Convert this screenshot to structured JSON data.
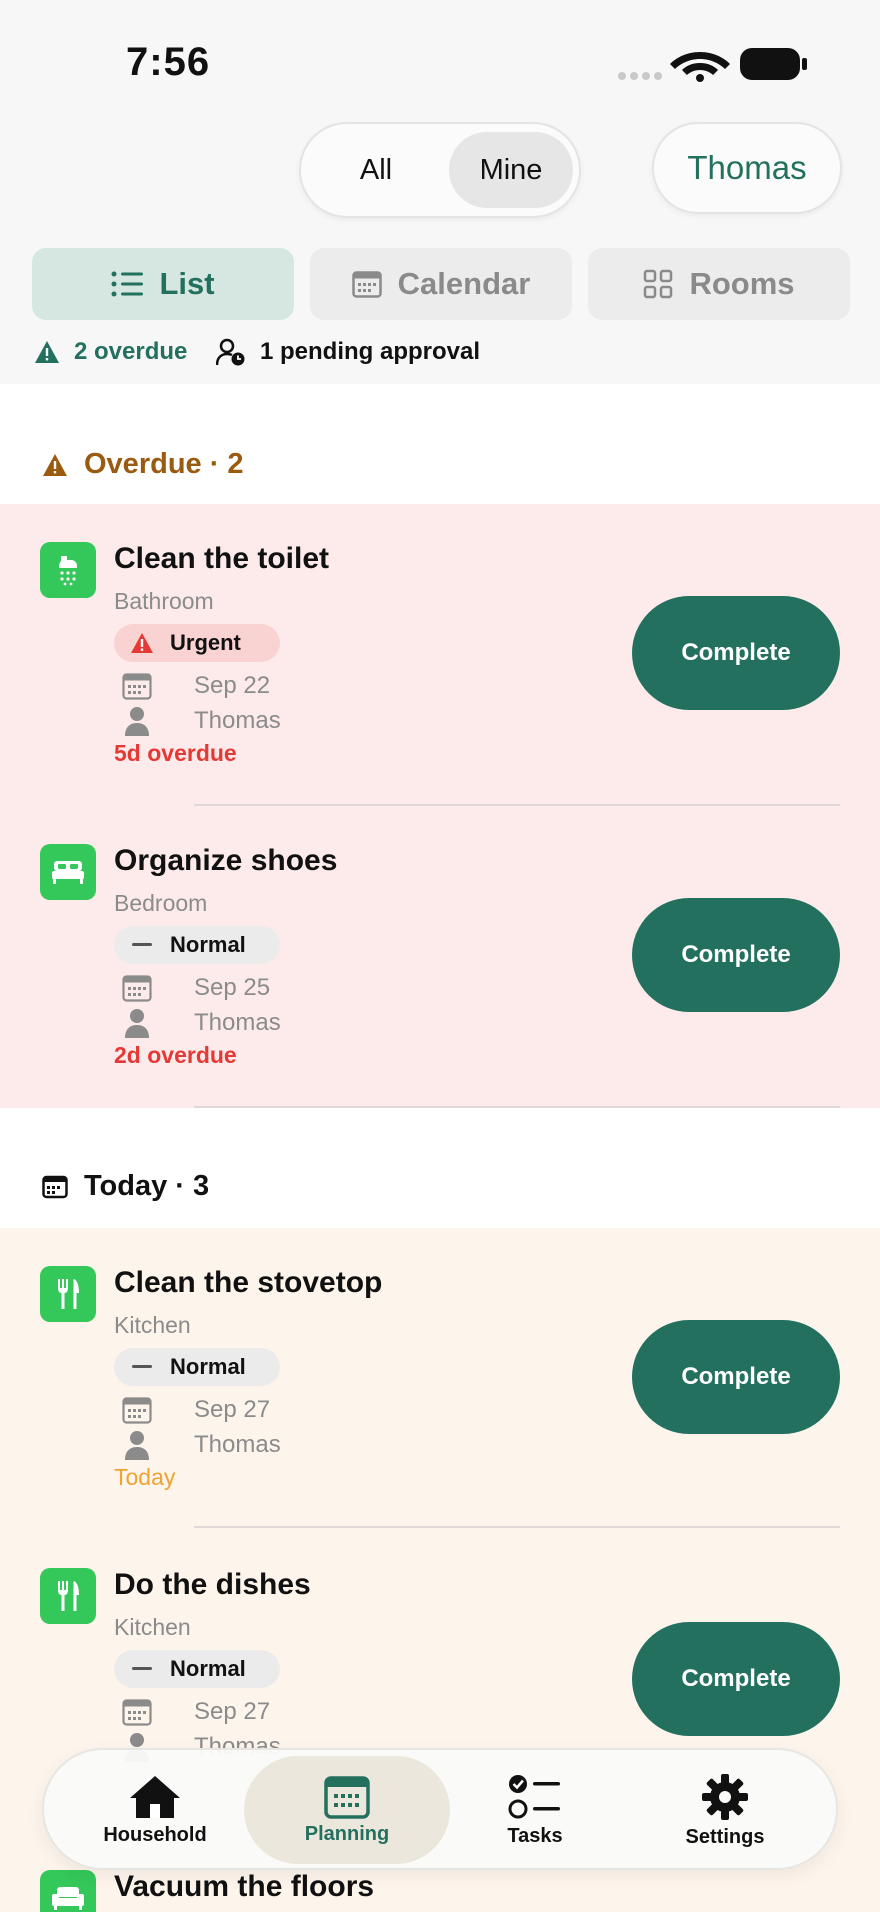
{
  "status_bar": {
    "time": "7:56"
  },
  "filter": {
    "all": "All",
    "mine": "Mine",
    "selected": "Mine"
  },
  "user": {
    "name": "Thomas"
  },
  "view_tabs": [
    {
      "label": "List",
      "icon": "list-icon",
      "active": true
    },
    {
      "label": "Calendar",
      "icon": "calendar-icon",
      "active": false
    },
    {
      "label": "Rooms",
      "icon": "grid-icon",
      "active": false
    }
  ],
  "summary": {
    "overdue": "2 overdue",
    "pending": "1 pending approval"
  },
  "sections": {
    "overdue": {
      "title": "Overdue · 2",
      "tasks": [
        {
          "title": "Clean the toilet",
          "room": "Bathroom",
          "priority": "Urgent",
          "date": "Sep 22",
          "assignee": "Thomas",
          "status": "5d overdue",
          "action": "Complete",
          "icon": "shower-icon"
        },
        {
          "title": "Organize shoes",
          "room": "Bedroom",
          "priority": "Normal",
          "date": "Sep 25",
          "assignee": "Thomas",
          "status": "2d overdue",
          "action": "Complete",
          "icon": "bed-icon"
        }
      ]
    },
    "today": {
      "title": "Today · 3",
      "tasks": [
        {
          "title": "Clean the stovetop",
          "room": "Kitchen",
          "priority": "Normal",
          "date": "Sep 27",
          "assignee": "Thomas",
          "status": "Today",
          "action": "Complete",
          "icon": "fork-knife-icon"
        },
        {
          "title": "Do the dishes",
          "room": "Kitchen",
          "priority": "Normal",
          "date": "Sep 27",
          "assignee": "Thomas",
          "status": "",
          "action": "Complete",
          "icon": "fork-knife-icon"
        },
        {
          "title": "Vacuum the floors",
          "icon": "sofa-icon"
        }
      ]
    }
  },
  "tabbar": [
    {
      "label": "Household",
      "icon": "house-icon"
    },
    {
      "label": "Planning",
      "icon": "planning-calendar-icon",
      "active": true
    },
    {
      "label": "Tasks",
      "icon": "checklist-icon"
    },
    {
      "label": "Settings",
      "icon": "gear-icon"
    }
  ],
  "colors": {
    "accent": "#23705f",
    "overdue_bg": "#fdebeb",
    "today_bg": "#fdf4ec",
    "room_icon": "#34c759",
    "overdue_text": "#e53935",
    "today_text": "#f0a330"
  }
}
